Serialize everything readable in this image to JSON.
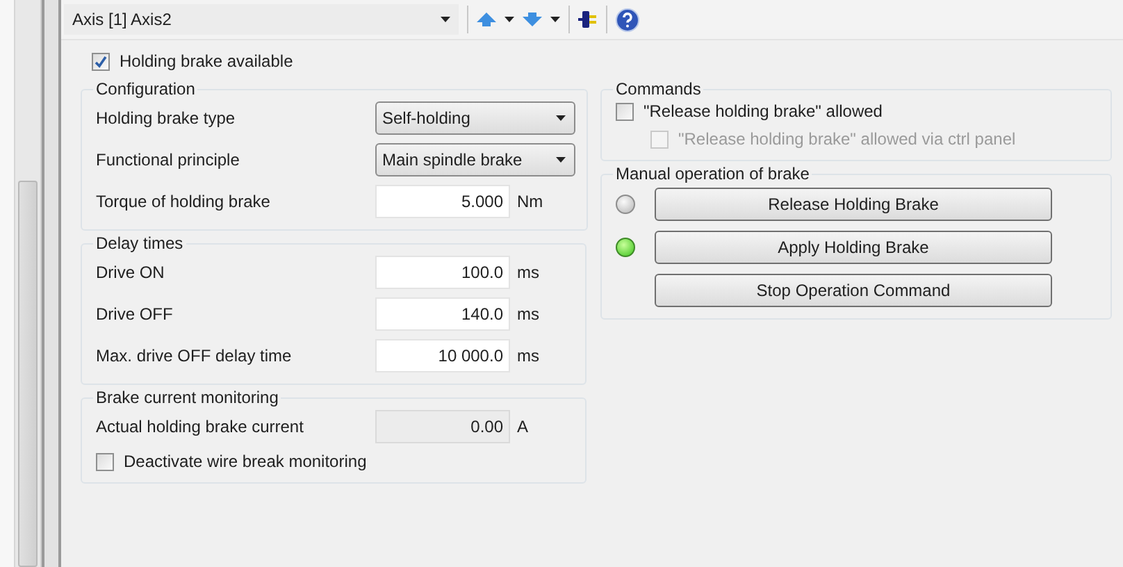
{
  "toolbar": {
    "axis_selector": "Axis [1] Axis2"
  },
  "holding_brake_available": {
    "label": "Holding brake available",
    "checked": true
  },
  "configuration": {
    "title": "Configuration",
    "rows": [
      {
        "kind": "select",
        "label": "Holding brake type",
        "value": "Self-holding"
      },
      {
        "kind": "select",
        "label": "Functional principle",
        "value": "Main spindle brake"
      },
      {
        "kind": "number",
        "label": "Torque of holding brake",
        "value": "5.000",
        "unit": "Nm"
      }
    ]
  },
  "delay_times": {
    "title": "Delay times",
    "rows": [
      {
        "kind": "number",
        "label": "Drive ON",
        "value": "100.0",
        "unit": "ms"
      },
      {
        "kind": "number",
        "label": "Drive OFF",
        "value": "140.0",
        "unit": "ms"
      },
      {
        "kind": "number",
        "label": "Max. drive OFF delay time",
        "value": "10 000.0",
        "unit": "ms"
      }
    ]
  },
  "brake_current_monitoring": {
    "title": "Brake current monitoring",
    "rows": [
      {
        "kind": "readonly",
        "label": "Actual holding brake current",
        "value": "0.00",
        "unit": "A"
      }
    ],
    "wire_break": {
      "label": "Deactivate wire break monitoring",
      "checked": false
    }
  },
  "commands": {
    "title": "Commands",
    "options": [
      {
        "label": "\"Release holding brake\" allowed",
        "checked": false,
        "disabled": false,
        "children": [
          {
            "label": "\"Release holding brake\" allowed via ctrl panel",
            "checked": false,
            "disabled": true
          }
        ]
      }
    ]
  },
  "manual_operation": {
    "title": "Manual operation of brake",
    "actions": [
      {
        "kind": "lamp",
        "label": "Release Holding Brake",
        "lit": false
      },
      {
        "kind": "lamp",
        "label": "Apply Holding Brake",
        "lit": true
      },
      {
        "kind": "plain",
        "label": "Stop Operation Command"
      }
    ]
  }
}
